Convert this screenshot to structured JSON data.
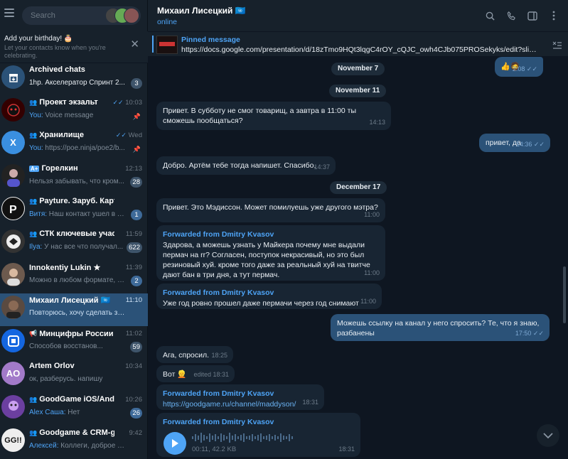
{
  "search": {
    "placeholder": "Search"
  },
  "birthday": {
    "title": "Add your birthday! 🎂",
    "subtitle": "Let your contacts know when you're celebrating.",
    "close": "✕"
  },
  "chats": [
    {
      "name": "Archived chats",
      "preview": "1hp. Акселератор Спринт 2...",
      "badge": "3",
      "avatar_color": "#2b5278"
    },
    {
      "name": "Проект экзальт",
      "group": true,
      "sender": "You:",
      "preview": " Voice message",
      "time": "10:03",
      "ticks": true,
      "avatar_color": "#300"
    },
    {
      "name": "Хранилище",
      "group": true,
      "sender": "You:",
      "preview": " https://poe.ninja/poe2/b...",
      "time": "Wed",
      "ticks": true,
      "avatar_color": "#3a8fe0",
      "avatar_letter": "X"
    },
    {
      "name": "Горелкин",
      "preview": "Нельзя забывать, что кром...",
      "time": "12:13",
      "badge": "28",
      "avatar_color": "#222"
    },
    {
      "name": "Payture. Заруб. Карты...",
      "group": true,
      "sender": "Витя:",
      "preview": " Наш контакт ушел в от...",
      "badge": "1",
      "avatar_color": "#111"
    },
    {
      "name": "СТК ключевые участн...",
      "group": true,
      "time": "11:59",
      "sender": "Ilya:",
      "preview": " У нас все что получал...",
      "badge": "622",
      "avatar_color": "#333"
    },
    {
      "name": "Innokentiy Lukin ★",
      "preview": "Можно в любом формате, х...",
      "time": "11:39",
      "badge": "2",
      "avatar_color": "#6d5a4e"
    },
    {
      "name": "Михаил Лисецкий 🇺🇳",
      "preview": "Повторюсь, хочу сделать за 2 дн...",
      "time": "11:10",
      "avatar_color": "#5a4a40",
      "active": true
    },
    {
      "name": "Минцифры России ✔",
      "preview": "Способов восстанов...",
      "time": "11:02",
      "badge": "59",
      "avatar_color": "#1466e0"
    },
    {
      "name": "Artem Orlov",
      "preview": "ок, разберусь. напишу",
      "time": "10:34",
      "avatar_color": "#a27ac9",
      "avatar_letter": "AO"
    },
    {
      "name": "GoodGame iOS/Android",
      "group": true,
      "sender": "Alex Саша:",
      "preview": " Нет",
      "time": "10:26",
      "badge": "26",
      "avatar_color": "#6b3fa0"
    },
    {
      "name": "Goodgame & CRM-group",
      "group": true,
      "sender": "Алексей:",
      "preview": " Коллеги, доброе утро! ...",
      "time": "9:42",
      "badge": "",
      "avatar_color": "#eee"
    }
  ],
  "header": {
    "name": "Михаил Лисецкий 🇺🇳",
    "status": "online"
  },
  "pinned": {
    "title": "Pinned message",
    "text": "https://docs.google.com/presentation/d/18zTmo9HQt3lqgC4rOY_cQJC_owh4CJb075PROSekyks/edit?slide=id.g..."
  },
  "dates": [
    "November 7",
    "November 11",
    "December 17"
  ],
  "messages": [
    {
      "dir": "out",
      "text": "👍🧔",
      "time": "2:08"
    },
    {
      "dir": "in",
      "text": "Привет. В субботу не смог товарищ, а завтра в 11:00 ты сможешь пообщаться?",
      "time": "14:13"
    },
    {
      "dir": "out",
      "text": "привет, да",
      "time": "14:36"
    },
    {
      "dir": "in",
      "text": "Добро. Артём тебе тогда напишет. Спасибо.",
      "time": "14:37"
    },
    {
      "dir": "in",
      "text": "Привет. Это Мэдиссон. Может помилуешь уже другого мэтра?",
      "time": "11:00"
    },
    {
      "dir": "in",
      "fwd": "Forwarded from Dmitry Kvasov",
      "text": "Здарова, а можешь узнать у Майкера почему мне выдали пермач на rr? Согласен, поступок некрасивый, но это был резиновый хуй. кроме того даже за реальный хуй на твитче дают бан в три дня, а тут пермач.",
      "time": "11:00"
    },
    {
      "dir": "in",
      "fwd": "Forwarded from Dmitry Kvasov",
      "text": "Уже год ровно прошел даже пермачи через год снимают",
      "time": "11:00"
    },
    {
      "dir": "out",
      "text": "Можешь ссылку на канал у него спросить? Те, что я знаю, разбанены",
      "time": "17:50"
    },
    {
      "dir": "in",
      "text": "Ага, спросил.",
      "time": "18:25"
    },
    {
      "dir": "in",
      "text": "Вот 👱",
      "time": "edited 18:31"
    },
    {
      "dir": "in",
      "fwd": "Forwarded from Dmitry Kvasov",
      "text": "https://goodgame.ru/channel/maddyson/",
      "time": "18:31"
    },
    {
      "dir": "in",
      "fwd": "Forwarded from Dmitry Kvasov",
      "voice": "00:11, 42.2 KB",
      "time": "18:31"
    }
  ]
}
